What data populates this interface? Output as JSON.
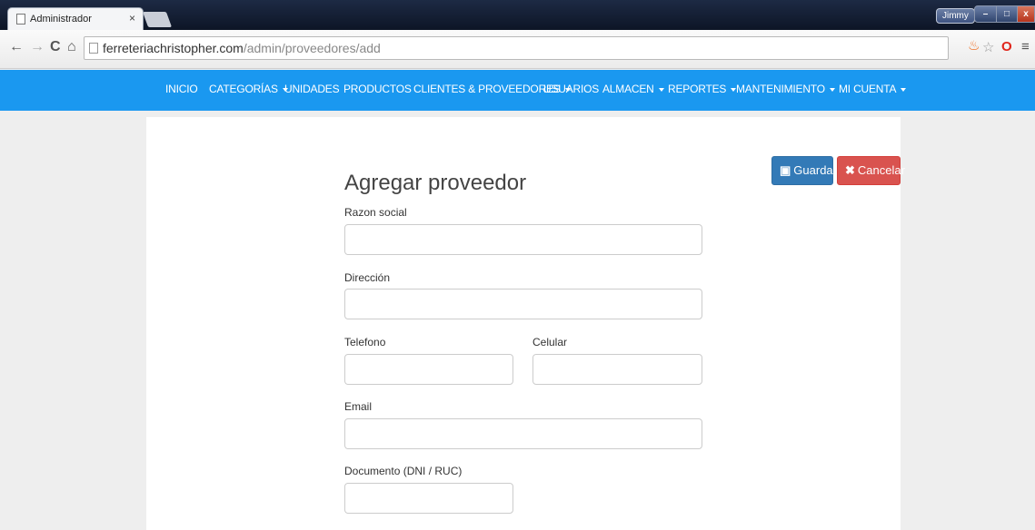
{
  "browser": {
    "tab_title": "Administrador",
    "tab_close": "×",
    "user_name": "Jimmy",
    "url_domain": "ferreteriachristopher.com",
    "url_path": "/admin/proveedores/add",
    "minimize_glyph": "–",
    "maximize_glyph": "□",
    "close_glyph": "x"
  },
  "navbar": {
    "items": [
      {
        "label": "INICIO",
        "dropdown": false
      },
      {
        "label": "CATEGORÍAS",
        "dropdown": true
      },
      {
        "label": "UNIDADES",
        "dropdown": false
      },
      {
        "label": "PRODUCTOS",
        "dropdown": false
      },
      {
        "label": "CLIENTES & PROVEEDORES",
        "dropdown": true
      },
      {
        "label": "USUARIOS",
        "dropdown": false
      },
      {
        "label": "ALMACEN",
        "dropdown": true
      },
      {
        "label": "REPORTES",
        "dropdown": true
      },
      {
        "label": "MANTENIMIENTO",
        "dropdown": true
      },
      {
        "label": "MI CUENTA",
        "dropdown": true
      }
    ]
  },
  "form": {
    "title": "Agregar proveedor",
    "save_label": "Guardar",
    "cancel_label": "Cancelar",
    "fields": {
      "razon_social": {
        "label": "Razon social",
        "value": ""
      },
      "direccion": {
        "label": "Dirección",
        "value": ""
      },
      "telefono": {
        "label": "Telefono",
        "value": ""
      },
      "celular": {
        "label": "Celular",
        "value": ""
      },
      "email": {
        "label": "Email",
        "value": ""
      },
      "documento": {
        "label": "Documento (DNI / RUC)",
        "value": ""
      }
    }
  },
  "colors": {
    "navbar": "#1a98f0",
    "save": "#337ab7",
    "cancel": "#d9534f"
  }
}
